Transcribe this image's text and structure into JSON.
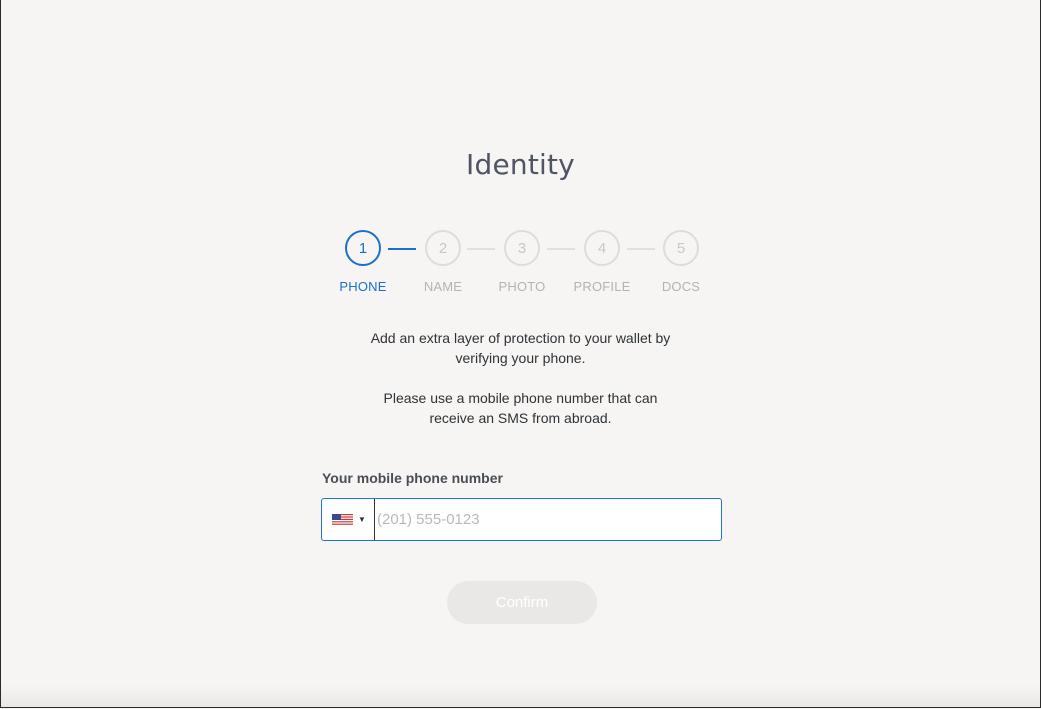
{
  "page": {
    "title": "Identity"
  },
  "stepper": {
    "active_step": 1,
    "steps": [
      {
        "number": "1",
        "label": "PHONE"
      },
      {
        "number": "2",
        "label": "NAME"
      },
      {
        "number": "3",
        "label": "PHOTO"
      },
      {
        "number": "4",
        "label": "PROFILE"
      },
      {
        "number": "5",
        "label": "DOCS"
      }
    ]
  },
  "description": {
    "line1": "Add an extra layer of protection to your wallet by",
    "line2": "verifying your phone.",
    "line3": "Please use a mobile phone number that can",
    "line4": "receive an SMS from abroad."
  },
  "phone": {
    "label": "Your mobile phone number",
    "country_icon": "us-flag-icon",
    "placeholder": "(201) 555-0123",
    "value": ""
  },
  "actions": {
    "confirm_label": "Confirm"
  },
  "colors": {
    "accent": "#1a6fd0",
    "inactive": "#c8c8c8",
    "background": "#f6f5f3",
    "disabled_button": "#e9e8e6"
  }
}
